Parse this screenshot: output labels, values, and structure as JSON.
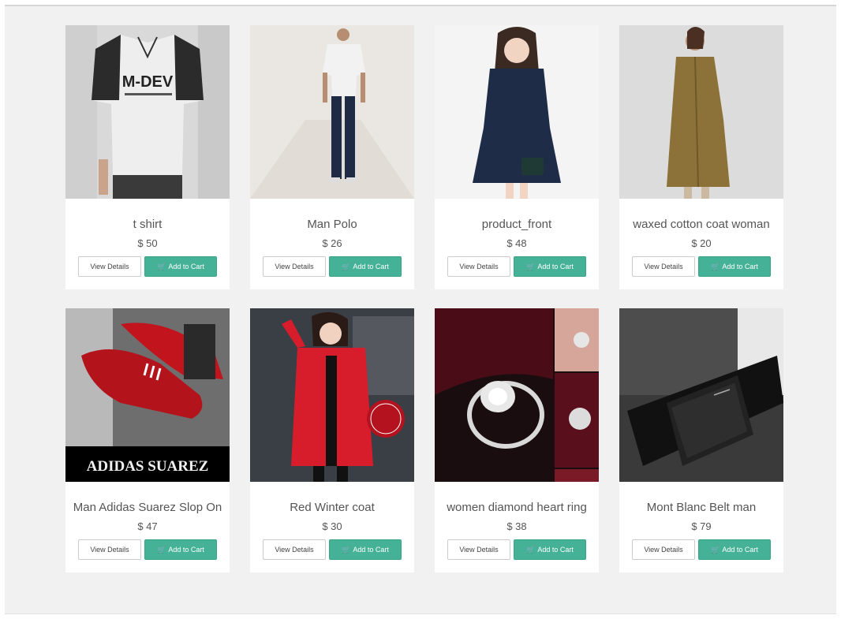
{
  "products": [
    {
      "name": "t shirt",
      "price": "$ 50",
      "image_icon": "tshirt-photo"
    },
    {
      "name": "Man Polo",
      "price": "$ 26",
      "image_icon": "man-walking-photo"
    },
    {
      "name": "product_front",
      "price": "$ 48",
      "image_icon": "woman-dress-photo"
    },
    {
      "name": "waxed cotton coat woman",
      "price": "$ 20",
      "image_icon": "woman-coat-photo"
    },
    {
      "name": "Man Adidas Suarez Slop On",
      "price": "$ 47",
      "image_icon": "red-shoes-photo",
      "image_caption": "ADIDAS SUAREZ"
    },
    {
      "name": "Red Winter coat",
      "price": "$ 30",
      "image_icon": "red-coat-photo"
    },
    {
      "name": "women diamond heart ring",
      "price": "$ 38",
      "image_icon": "diamond-ring-photo"
    },
    {
      "name": "Mont Blanc Belt man",
      "price": "$ 79",
      "image_icon": "belt-photo"
    }
  ],
  "buttons": {
    "view_details": "View Details",
    "add_to_cart": "Add to Cart",
    "cart_icon": "shopping-cart-icon"
  },
  "colors": {
    "accent": "#45b196",
    "background": "#f1f1f1",
    "card": "#ffffff",
    "text": "#555555"
  }
}
